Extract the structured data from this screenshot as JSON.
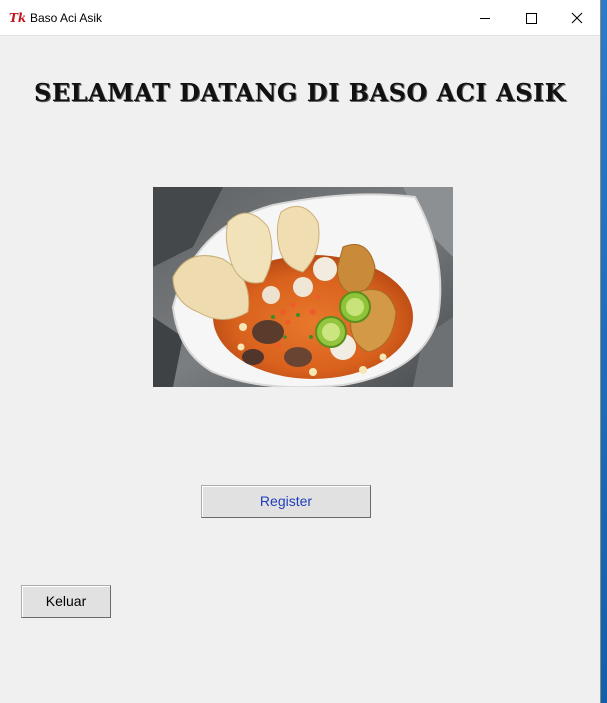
{
  "window": {
    "title": "Baso Aci Asik",
    "logo_text": "Tk"
  },
  "caption_buttons": {
    "minimize": "minimize-icon",
    "maximize": "maximize-icon",
    "close": "close-icon"
  },
  "main": {
    "heading": "SELAMAT DATANG DI BASO ACI ASIK",
    "image": "baso-aci-bowl-photo",
    "register_label": "Register",
    "exit_label": "Keluar"
  },
  "colors": {
    "window_bg": "#f0f0f0",
    "register_text": "#1f3fb8",
    "logo_red": "#c2171d"
  }
}
